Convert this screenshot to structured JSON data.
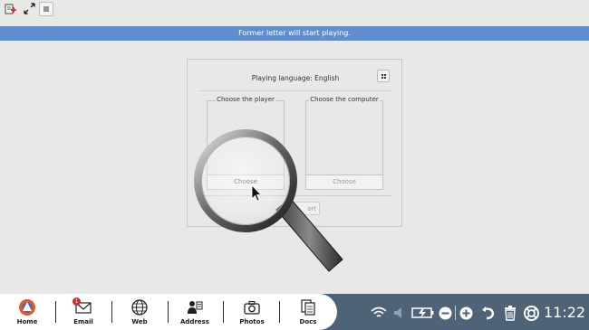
{
  "toolbar": {
    "new_icon": "new-document-icon",
    "fullscreen_icon": "fullscreen-icon",
    "menu_icon": "hamburger-menu-icon"
  },
  "banner": {
    "text": "Former letter will start playing."
  },
  "panel": {
    "language_label": "Playing language: English",
    "player_group": {
      "title": "Choose the player",
      "button": "Choose"
    },
    "computer_group": {
      "title": "Choose the computer",
      "button": "Choose"
    },
    "start_button": "Start game",
    "start_button_visible": "art game"
  },
  "taskbar": {
    "apps": [
      {
        "label": "Home",
        "icon": "home-logo-icon"
      },
      {
        "label": "Email",
        "icon": "envelope-icon",
        "badge": "1"
      },
      {
        "label": "Web",
        "icon": "globe-icon"
      },
      {
        "label": "Address",
        "icon": "contacts-icon"
      },
      {
        "label": "Photos",
        "icon": "camera-icon"
      },
      {
        "label": "Docs",
        "icon": "documents-icon"
      }
    ],
    "tray": {
      "clock": "11:22",
      "icons": [
        "wifi-icon",
        "volume-icon",
        "battery-charging-icon",
        "zoom-out-icon",
        "zoom-in-icon",
        "undo-icon",
        "trash-icon",
        "help-lifebuoy-icon"
      ]
    }
  },
  "colors": {
    "banner": "#5d8fd0",
    "taskbar": "#4f6378",
    "background": "#e8e8e7"
  }
}
